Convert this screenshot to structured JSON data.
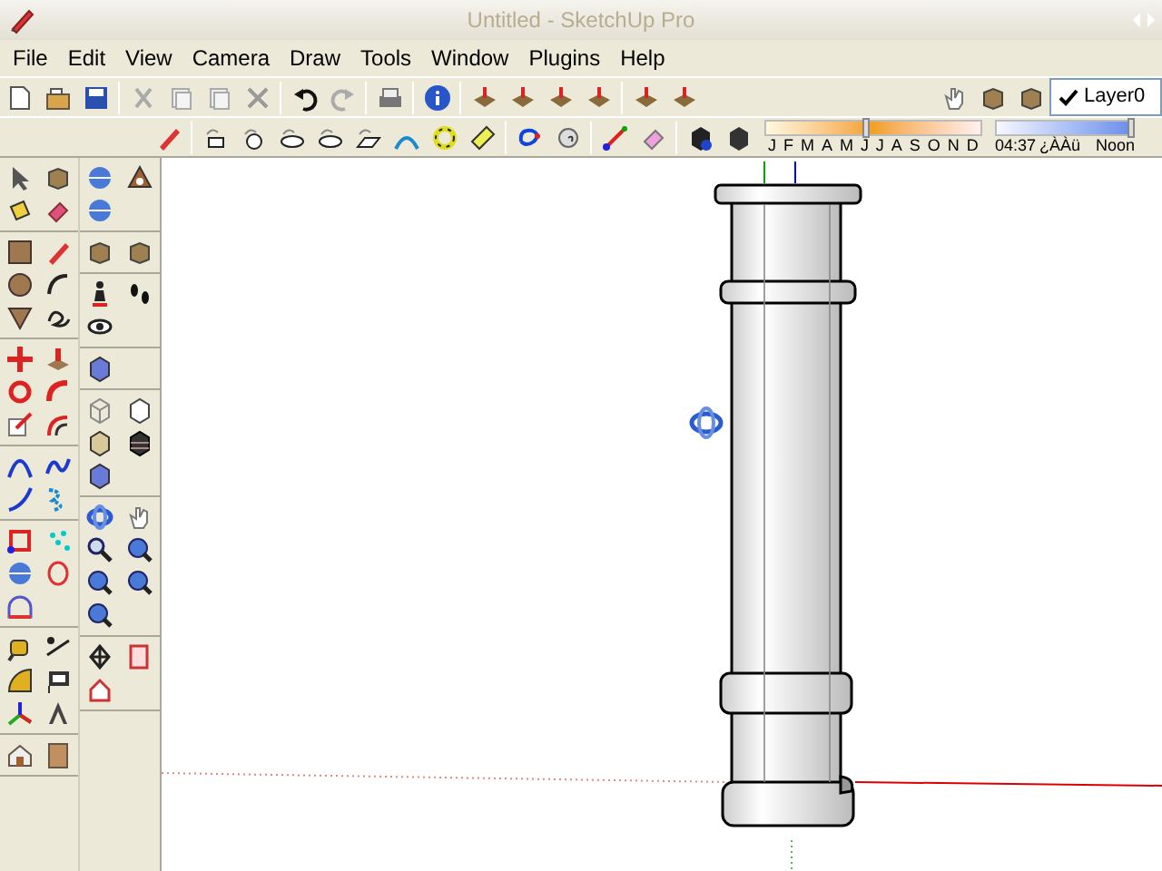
{
  "window": {
    "title": "Untitled - SketchUp Pro"
  },
  "menu": [
    {
      "label": "File"
    },
    {
      "label": "Edit"
    },
    {
      "label": "View"
    },
    {
      "label": "Camera"
    },
    {
      "label": "Draw"
    },
    {
      "label": "Tools"
    },
    {
      "label": "Window"
    },
    {
      "label": "Plugins"
    },
    {
      "label": "Help"
    }
  ],
  "layers": {
    "current": "Layer0",
    "checked": true
  },
  "shadows": {
    "months": [
      "J",
      "F",
      "M",
      "A",
      "M",
      "J",
      "J",
      "A",
      "S",
      "O",
      "N",
      "D"
    ],
    "date_slider": {
      "level": 0.47
    },
    "time": "04:37",
    "meridiem": "¿ÀÀü",
    "noon": "Noon",
    "time_slider": {
      "level": 0.98
    }
  }
}
